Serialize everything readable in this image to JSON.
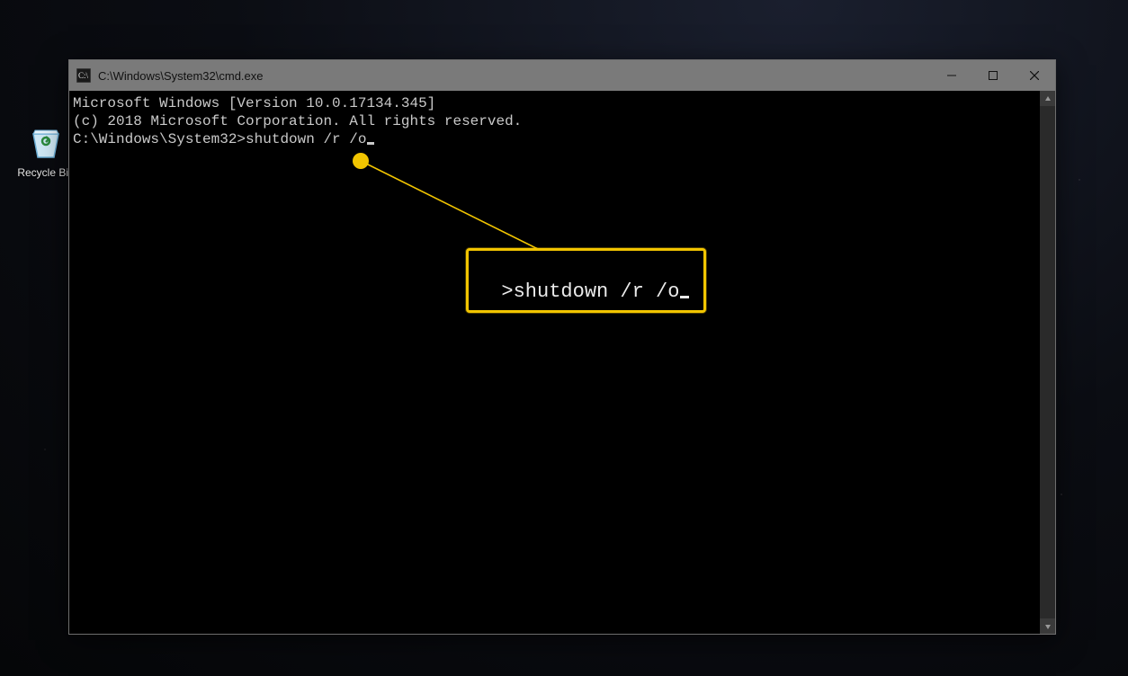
{
  "desktop": {
    "recycle_bin_label": "Recycle Bin"
  },
  "window": {
    "title": "C:\\Windows\\System32\\cmd.exe",
    "controls": {
      "minimize_title": "Minimize",
      "maximize_title": "Maximize",
      "close_title": "Close"
    }
  },
  "console": {
    "line1": "Microsoft Windows [Version 10.0.17134.345]",
    "line2": "(c) 2018 Microsoft Corporation. All rights reserved.",
    "blank": "",
    "prompt_prefix": "C:\\Windows\\System32>",
    "command": "shutdown /r /o"
  },
  "annotation": {
    "callout_text": ">shutdown /r /o"
  }
}
